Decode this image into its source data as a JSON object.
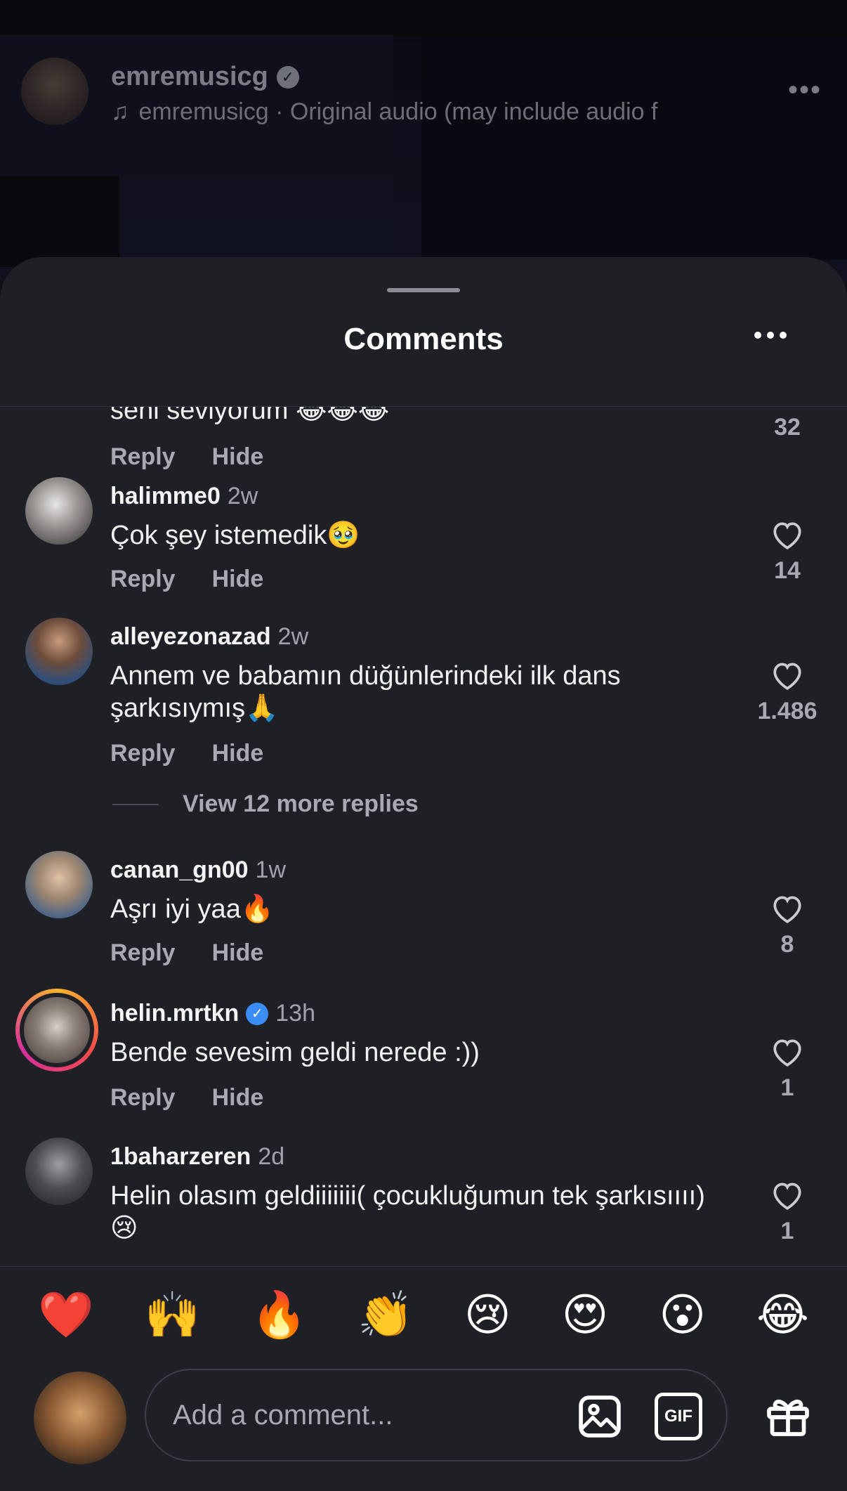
{
  "post": {
    "username": "emremusicg",
    "audio": "emremusicg · Original audio  (may include audio f"
  },
  "sheet": {
    "title": "Comments"
  },
  "comments": [
    {
      "text": "seni seviyorum 😂😂😂",
      "likes": "32",
      "reply": "Reply",
      "hide": "Hide"
    },
    {
      "username": "halimme0",
      "time": "2w",
      "text": "Çok şey istemedik🥹",
      "likes": "14",
      "reply": "Reply",
      "hide": "Hide"
    },
    {
      "username": "alleyezonazad",
      "time": "2w",
      "text": "Annem ve babamın düğünlerindeki ilk dans şarkısıymış🙏",
      "likes": "1.486",
      "reply": "Reply",
      "hide": "Hide",
      "more_replies": "View 12 more replies"
    },
    {
      "username": "canan_gn00",
      "time": "1w",
      "text": "Aşrı iyi yaa🔥",
      "likes": "8",
      "reply": "Reply",
      "hide": "Hide"
    },
    {
      "username": "helin.mrtkn",
      "time": "13h",
      "text": "Bende sevesim geldi nerede :))",
      "likes": "1",
      "reply": "Reply",
      "hide": "Hide",
      "verified": true
    },
    {
      "username": "1baharzeren",
      "time": "2d",
      "text": "Helin olasım geldiiiiiii( çocukluğumun tek şarkısıııı)😢",
      "likes": "1"
    }
  ],
  "quick_reactions": [
    "❤️",
    "🙌",
    "🔥",
    "👏",
    "😢",
    "😍",
    "😮",
    "😂"
  ],
  "composer": {
    "placeholder": "Add a comment...",
    "gif_label": "GIF"
  },
  "colors": {
    "sheet_bg": "#1e2026",
    "muted_text": "#a7aab0",
    "verified_blue": "#3a8df5"
  }
}
